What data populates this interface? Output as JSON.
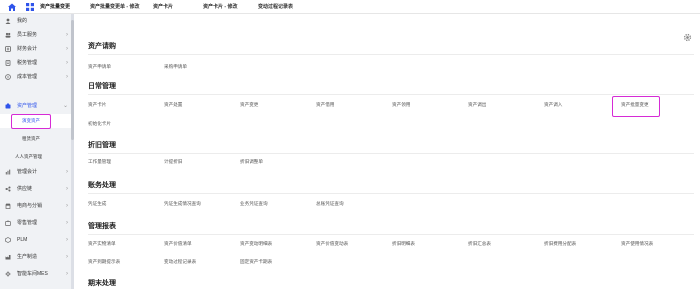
{
  "topbar": {
    "tabs": [
      "资产批量变更",
      "资产批量变更单 - 修改",
      "资产卡片",
      "资产卡片 - 修改",
      "变动过程记录表"
    ]
  },
  "sidebar": {
    "items": [
      {
        "label": "我的",
        "icon": "user-icon"
      },
      {
        "label": "员工服务",
        "icon": "people-icon"
      },
      {
        "label": "财务会计",
        "icon": "finance-icon"
      },
      {
        "label": "税务管理",
        "icon": "tax-icon"
      },
      {
        "label": "成本管理",
        "icon": "cost-icon"
      },
      {
        "label": "资产管理",
        "icon": "asset-icon"
      },
      {
        "label": "管理会计",
        "icon": "chart-icon"
      },
      {
        "label": "供应链",
        "icon": "supply-icon"
      },
      {
        "label": "电商与分销",
        "icon": "shop-icon"
      },
      {
        "label": "零售管理",
        "icon": "retail-icon"
      },
      {
        "label": "PLM",
        "icon": "plm-icon"
      },
      {
        "label": "生产制造",
        "icon": "factory-icon"
      },
      {
        "label": "智能车间MES",
        "icon": "mes-icon"
      }
    ],
    "subitems": [
      "演变资产",
      "租赁资产",
      "人人资产管理"
    ]
  },
  "main": {
    "sections": [
      {
        "title": "资产请购",
        "links": [
          "资产申请单",
          "采购申请单"
        ]
      },
      {
        "title": "日常管理",
        "links": [
          "资产卡片",
          "资产处置",
          "资产变更",
          "资产借用",
          "资产领用",
          "资产调出",
          "资产调入",
          "资产批量变更",
          "初始化卡片"
        ]
      },
      {
        "title": "折旧管理",
        "links": [
          "工作量管理",
          "计提折旧",
          "折旧调整单"
        ]
      },
      {
        "title": "账务处理",
        "links": [
          "凭证生成",
          "凭证生成情况查询",
          "业务凭证查询",
          "总账凭证查询"
        ]
      },
      {
        "title": "管理报表",
        "links": [
          "资产实物清单",
          "资产价值清单",
          "资产变动明细表",
          "资产价值变动表",
          "折旧明细表",
          "折旧汇总表",
          "折旧费用分配表",
          "资产使用情况表",
          "资产到期提示表",
          "变动过程记录表",
          "固定资产卡期表"
        ]
      },
      {
        "title": "期末处理",
        "links": []
      }
    ]
  }
}
